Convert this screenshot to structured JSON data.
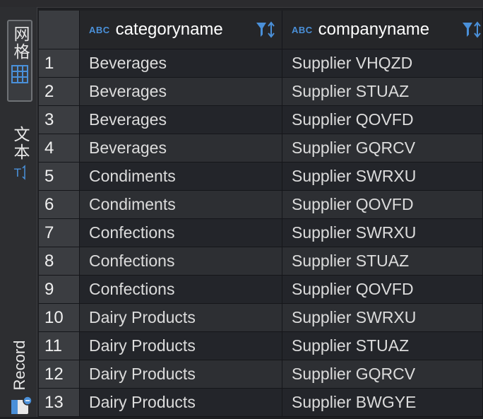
{
  "sidebar": {
    "grid_tab": "网格",
    "text_tab": "文本",
    "record_tab": "Record"
  },
  "columns": [
    {
      "type_badge": "ABC",
      "name": "categoryname"
    },
    {
      "type_badge": "ABC",
      "name": "companyname"
    }
  ],
  "rows": [
    {
      "num": "1",
      "category": "Beverages",
      "company": "Supplier VHQZD"
    },
    {
      "num": "2",
      "category": "Beverages",
      "company": "Supplier STUAZ"
    },
    {
      "num": "3",
      "category": "Beverages",
      "company": "Supplier QOVFD"
    },
    {
      "num": "4",
      "category": "Beverages",
      "company": "Supplier GQRCV"
    },
    {
      "num": "5",
      "category": "Condiments",
      "company": "Supplier SWRXU"
    },
    {
      "num": "6",
      "category": "Condiments",
      "company": "Supplier QOVFD"
    },
    {
      "num": "7",
      "category": "Confections",
      "company": "Supplier SWRXU"
    },
    {
      "num": "8",
      "category": "Confections",
      "company": "Supplier STUAZ"
    },
    {
      "num": "9",
      "category": "Confections",
      "company": "Supplier QOVFD"
    },
    {
      "num": "10",
      "category": "Dairy Products",
      "company": "Supplier SWRXU"
    },
    {
      "num": "11",
      "category": "Dairy Products",
      "company": "Supplier STUAZ"
    },
    {
      "num": "12",
      "category": "Dairy Products",
      "company": "Supplier GQRCV"
    },
    {
      "num": "13",
      "category": "Dairy Products",
      "company": "Supplier BWGYE"
    }
  ],
  "colors": {
    "accent": "#4a90d9",
    "background": "#1e1f22"
  }
}
